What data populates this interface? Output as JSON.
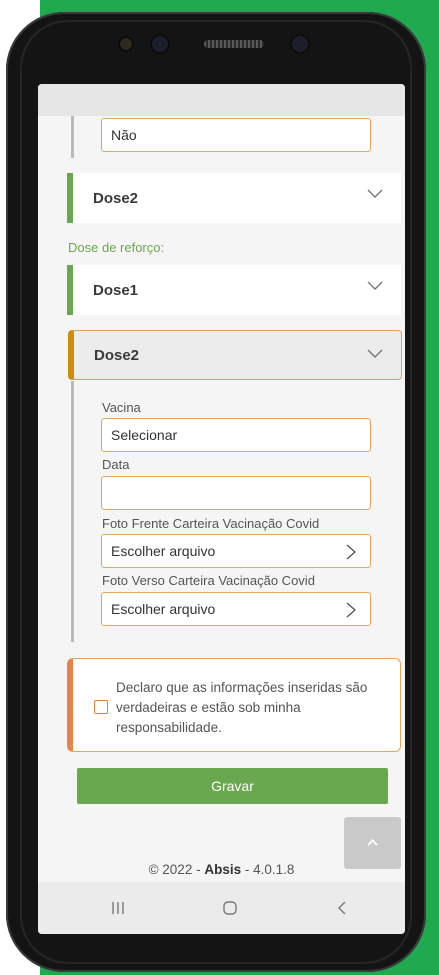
{
  "top_card": {
    "value": "Não"
  },
  "cards": {
    "dose2_primary": "Dose2",
    "booster_label": "Dose de reforço:",
    "dose1_booster": "Dose1",
    "dose2_booster": "Dose2"
  },
  "form": {
    "vacina_label": "Vacina",
    "vacina_value": "Selecionar",
    "data_label": "Data",
    "data_value": "",
    "foto_frente_label": "Foto Frente Carteira Vacinação Covid",
    "foto_frente_button": "Escolher arquivo",
    "foto_verso_label": "Foto Verso Carteira Vacinação Covid",
    "foto_verso_button": "Escolher arquivo"
  },
  "declaration": {
    "text": "Declaro que as informações inseridas são verdadeiras e estão sob minha responsabilidade.",
    "checked": false
  },
  "actions": {
    "save_label": "Gravar"
  },
  "footer": {
    "copyright_prefix": "© 2022 - ",
    "brand": "Absis",
    "version_suffix": " - 4.0.1.8"
  },
  "colors": {
    "background_green": "#1faa4f",
    "accent_green": "#6aa84f",
    "active_orange": "#d08a0c",
    "input_border": "#e9a45a"
  },
  "icons": [
    "chevron-down-icon",
    "chevron-up-icon",
    "chevron-right-icon",
    "recent-apps-icon",
    "home-icon",
    "back-icon"
  ]
}
